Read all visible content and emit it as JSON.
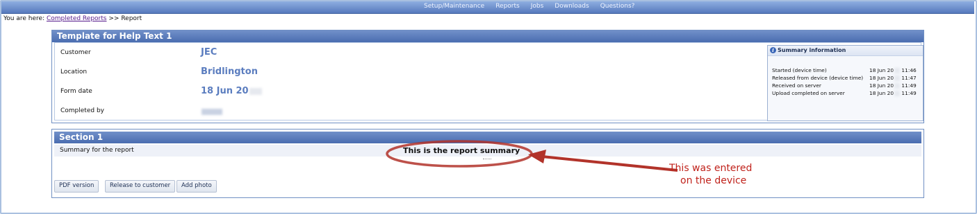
{
  "nav": {
    "items": [
      "Setup/Maintenance",
      "Reports",
      "Jobs",
      "Downloads",
      "Questions?"
    ],
    "accent": "#5679bd"
  },
  "breadcrumb": {
    "prefix": "You are here:",
    "link": "Completed Reports",
    "separator": ">>",
    "current": "Report"
  },
  "template": {
    "title": "Template for Help Text 1",
    "fields": [
      {
        "label": "Customer",
        "value": "JEC"
      },
      {
        "label": "Location",
        "value": "Bridlington"
      },
      {
        "label": "Form date",
        "value": "18 Jun 20"
      },
      {
        "label": "Completed by",
        "value": ""
      }
    ]
  },
  "summary_info": {
    "title": "Summary information",
    "icon": "info-icon",
    "rows": [
      {
        "label": "Started (device time)",
        "date": "18 Jun 20",
        "time": "11:46"
      },
      {
        "label": "Released from device (device time)",
        "date": "18 Jun 20",
        "time": "11:47"
      },
      {
        "label": "Received on server",
        "date": "18 Jun 20",
        "time": "11:49"
      },
      {
        "label": "Upload completed on server",
        "date": "18 Jun 20",
        "time": "11:49"
      }
    ]
  },
  "section": {
    "title": "Section 1",
    "summary_label": "Summary for the report",
    "summary_value": "This is the report summary"
  },
  "buttons": {
    "pdf": "PDF version",
    "release": "Release to customer",
    "photo": "Add photo"
  },
  "annotation": {
    "line1": "This was entered",
    "line2": "on the device",
    "color": "#c0221b"
  }
}
